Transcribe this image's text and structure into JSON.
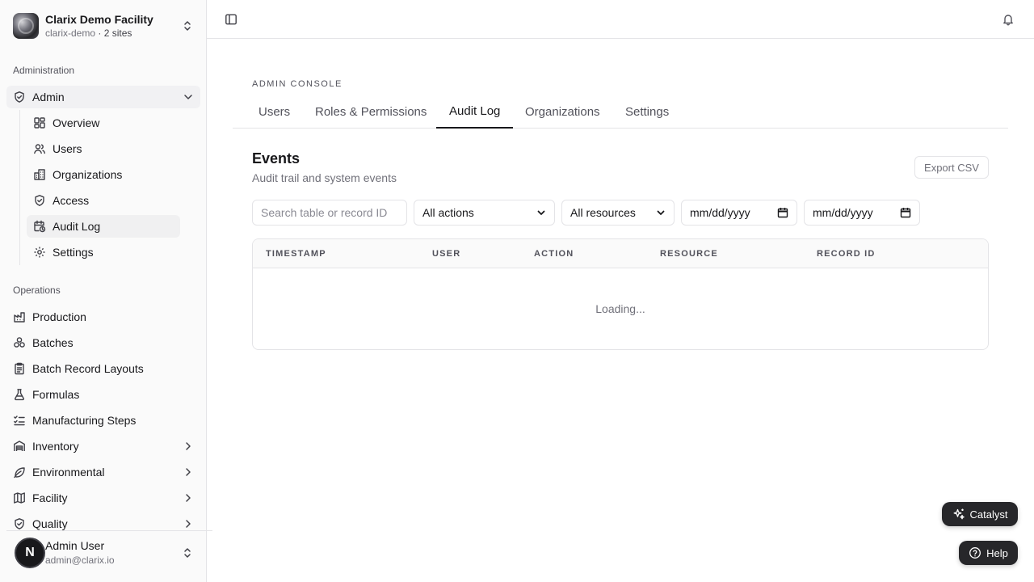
{
  "org": {
    "name": "Clarix Demo Facility",
    "slug": "clarix-demo",
    "sep": "·",
    "sites": "2 sites"
  },
  "sidebar": {
    "admin_section": "Administration",
    "admin_item": "Admin",
    "admin_sub": [
      {
        "label": "Overview"
      },
      {
        "label": "Users"
      },
      {
        "label": "Organizations"
      },
      {
        "label": "Access"
      },
      {
        "label": "Audit Log"
      },
      {
        "label": "Settings"
      }
    ],
    "ops_section": "Operations",
    "ops_items": [
      {
        "label": "Production"
      },
      {
        "label": "Batches"
      },
      {
        "label": "Batch Record Layouts"
      },
      {
        "label": "Formulas"
      },
      {
        "label": "Manufacturing Steps"
      },
      {
        "label": "Inventory"
      },
      {
        "label": "Environmental"
      },
      {
        "label": "Facility"
      },
      {
        "label": "Quality"
      }
    ]
  },
  "user": {
    "initial": "N",
    "name": "Admin User",
    "email": "admin@clarix.io"
  },
  "main": {
    "eyebrow": "ADMIN CONSOLE",
    "tabs": [
      {
        "label": "Users"
      },
      {
        "label": "Roles & Permissions"
      },
      {
        "label": "Audit Log"
      },
      {
        "label": "Organizations"
      },
      {
        "label": "Settings"
      }
    ],
    "active_tab": "Audit Log",
    "title": "Events",
    "subtitle": "Audit trail and system events",
    "export_label": "Export CSV",
    "filters": {
      "search_placeholder": "Search table or record ID",
      "action_value": "All actions",
      "resource_value": "All resources",
      "date_from_placeholder": "mm/dd/yyyy",
      "date_to_placeholder": "mm/dd/yyyy"
    },
    "table": {
      "columns": [
        "TIMESTAMP",
        "USER",
        "ACTION",
        "RESOURCE",
        "RECORD ID"
      ],
      "loading_text": "Loading..."
    }
  },
  "floating": {
    "catalyst_label": "Catalyst",
    "help_label": "Help"
  }
}
